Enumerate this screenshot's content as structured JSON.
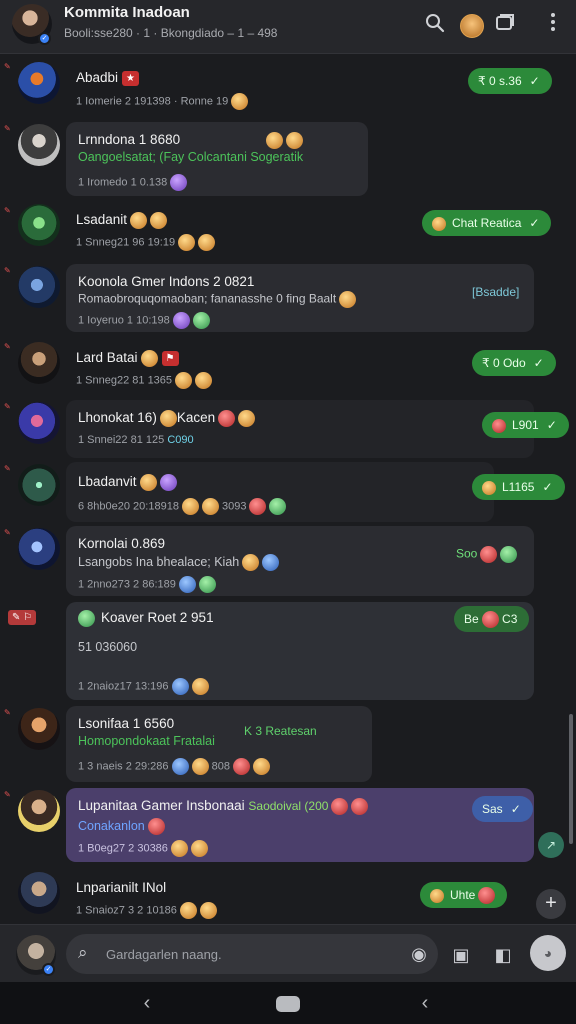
{
  "header": {
    "title": "Kommita Inadoan",
    "subtitle": "Booli:sse280 · 1 · Bkongdiado – 1 – 498",
    "search_icon": "search-icon",
    "sticker_icon": "emoji-icon",
    "video_icon": "video-call-icon",
    "more_icon": "more-vertical-icon"
  },
  "chats": [
    {
      "name": "Abadbi",
      "badge": "★",
      "meta": "1 Iomerie 2 191398 · Ronne 19",
      "tag": "₹ 0 s.36"
    },
    {
      "name": "Lrnndona 1 8680",
      "sub": "Oangoelsatat; (Fay Colcantani Sogeratik",
      "meta": "1 Iromedo 1 0.138"
    },
    {
      "name": "Lsadanit",
      "meta": "1 Snneg21 96 19:19",
      "tag": "Chat Reatica"
    },
    {
      "name": "Koonola Gmer Indons 2 0821",
      "sub": "Romaobroquqomaoban; fananasshe 0 fing Baalt",
      "meta": "1 Ioyeruo 1 10:198",
      "tag_text": "[Bsadde]"
    },
    {
      "name": "Lard Batai",
      "meta": "1 Snneg22 81 1365",
      "tag": "₹ 0 Odo"
    },
    {
      "name": "Lhonokat 16)",
      "tail": "Kacen",
      "meta": "1 Snnei22 81 125",
      "meta2": "C090",
      "tag": "L901"
    },
    {
      "name": "Lbadanvit",
      "meta": "6 8hb0e20 20:18918",
      "meta2": "3093",
      "tag": "L1165"
    },
    {
      "name": "Kornolai 0.869",
      "sub": "Lsangobs Ina bhealace; Kiah",
      "meta": "1 2nno273 2 86:189",
      "tag": "Soo"
    },
    {
      "name": "Koaver Roet 2 951",
      "sub": "51 036060",
      "meta": "1 2naioz17 13:196",
      "tag": "C3",
      "tag_prefix": "Be"
    },
    {
      "name": "Lsonifaa 1 6560",
      "sub": "Homopondokaat Fratalai",
      "tag_text": "K 3 Reatesan",
      "meta": "1 3 naeis 2 29:286",
      "meta2": "808"
    },
    {
      "name": "Lupanitaa Gamer Insbonaai",
      "name_tail": "Saodoival (200",
      "sub": "Conakanlon",
      "meta": "1 B0eg27 2 30386",
      "tag": "Sas"
    },
    {
      "name": "Lnparianilt",
      "name_tail": "INol",
      "meta": "1 Snaioz7 3 2 10186",
      "tag": "Uhte"
    }
  ],
  "compose": {
    "placeholder": "Gardagarlen naang.",
    "search_icon": "search-icon",
    "camera_icon": "camera-icon",
    "sticker_icon": "sticker-icon",
    "mic_icon": "mic-icon"
  },
  "nav": {
    "back": "‹",
    "home": "home",
    "recents": "‹"
  }
}
